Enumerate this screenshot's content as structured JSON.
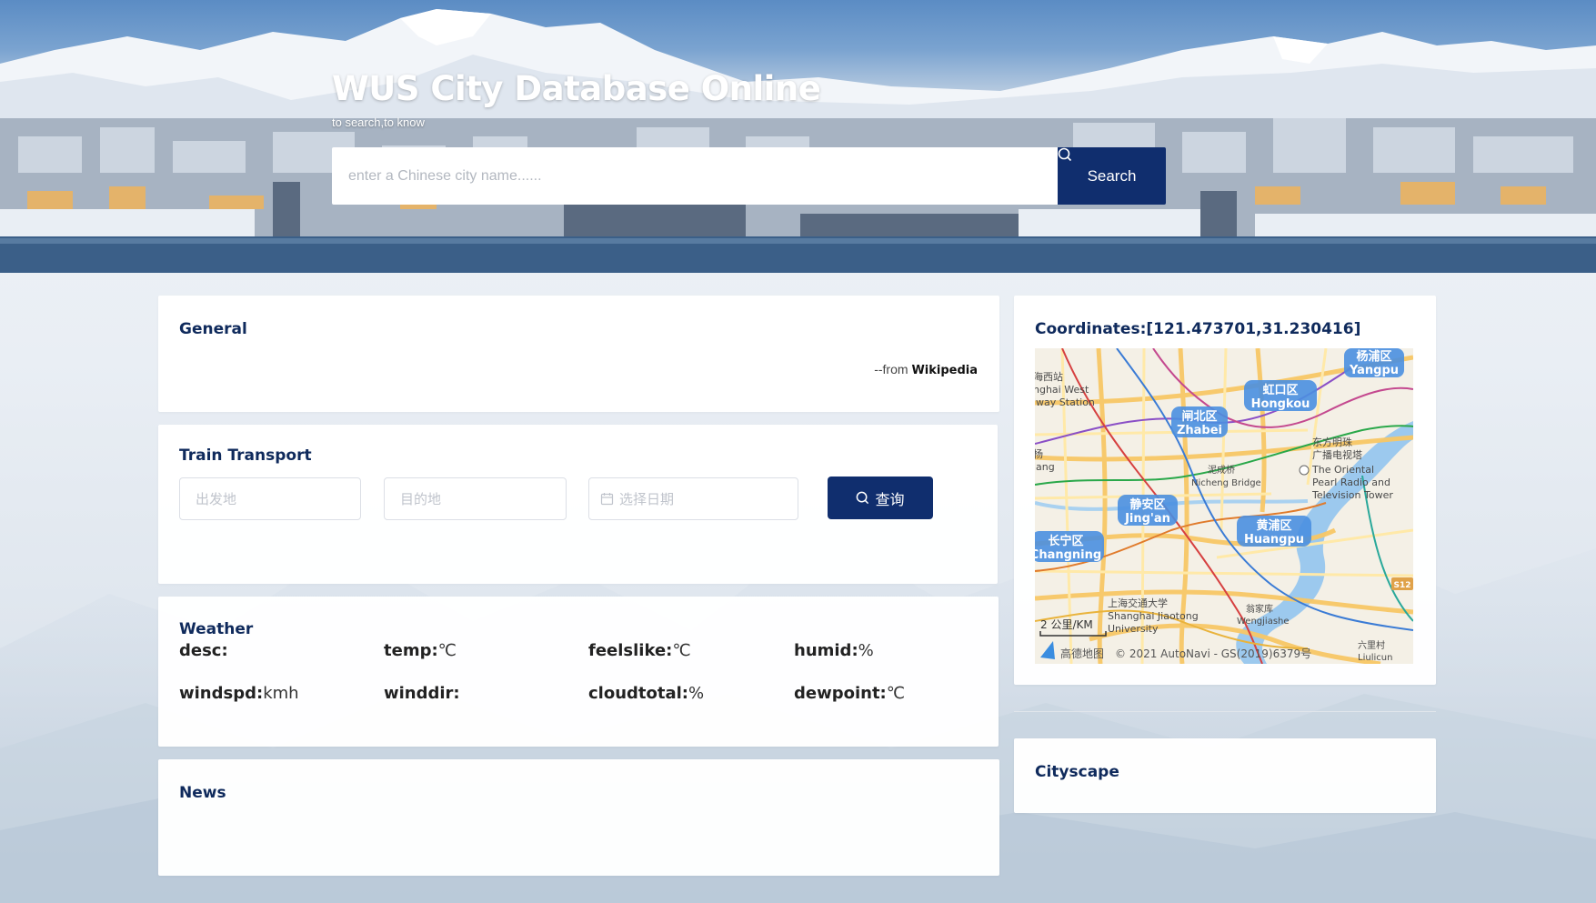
{
  "hero": {
    "title": "WUS City Database Online",
    "subtitle": "to search,to know",
    "search_placeholder": "enter a Chinese city name......",
    "search_label": "Search"
  },
  "general": {
    "title": "General",
    "source_prefix": "--from ",
    "source_name": "Wikipedia"
  },
  "train": {
    "title": "Train Transport",
    "from_placeholder": "出发地",
    "to_placeholder": "目的地",
    "date_placeholder": "选择日期",
    "query_label": "查询"
  },
  "weather": {
    "title": "Weather",
    "fields": [
      {
        "label": "desc:",
        "unit": ""
      },
      {
        "label": "temp:",
        "unit": "℃"
      },
      {
        "label": "feelslike:",
        "unit": "℃"
      },
      {
        "label": "humid:",
        "unit": "%"
      },
      {
        "label": "windspd:",
        "unit": "kmh"
      },
      {
        "label": "winddir:",
        "unit": ""
      },
      {
        "label": "cloudtotal:",
        "unit": "%"
      },
      {
        "label": "dewpoint:",
        "unit": "℃"
      }
    ]
  },
  "news": {
    "title": "News"
  },
  "coordinates": {
    "title": "Coordinates:[121.473701,31.230416]",
    "map": {
      "labels": [
        {
          "cn": "杨浦区",
          "en": "Yangpu"
        },
        {
          "cn": "虹口区",
          "en": "Hongkou"
        },
        {
          "cn": "闸北区",
          "en": "Zhabei"
        },
        {
          "cn": "静安区",
          "en": "Jing'an"
        },
        {
          "cn": "黄浦区",
          "en": "Huangpu"
        },
        {
          "cn": "长宁区",
          "en": "Changning"
        }
      ],
      "station_cn": "海西站",
      "station_en_1": "nghai West",
      "station_en_2": "lway Station",
      "side_text_1": "杨",
      "side_text_2": "lang",
      "tower_cn_1": "东方明珠",
      "tower_cn_2": "广播电视塔",
      "tower_en_1": "The Oriental",
      "tower_en_2": "Pearl Radio and",
      "tower_en_3": "Television Tower",
      "bridge_cn": "泥成桥",
      "bridge_en": "Nicheng Bridge",
      "univ_cn": "上海交通大学",
      "univ_en_1": "Shanghai Jiaotong",
      "univ_en_2": "University",
      "wengjiashe_cn": "翁家库",
      "wengjiashe_en": "Wengjiashe",
      "liulicun_cn": "六里村",
      "liulicun_en": "Liulicun",
      "road_badge": "S12",
      "scale": "2 公里/KM",
      "copyright_brand": "高德地图",
      "copyright": "© 2021 AutoNavi - GS(2019)6379号"
    }
  },
  "cityscape": {
    "title": "Cityscape"
  },
  "colors": {
    "primary": "#102e6e",
    "title": "#0f2a5c"
  }
}
